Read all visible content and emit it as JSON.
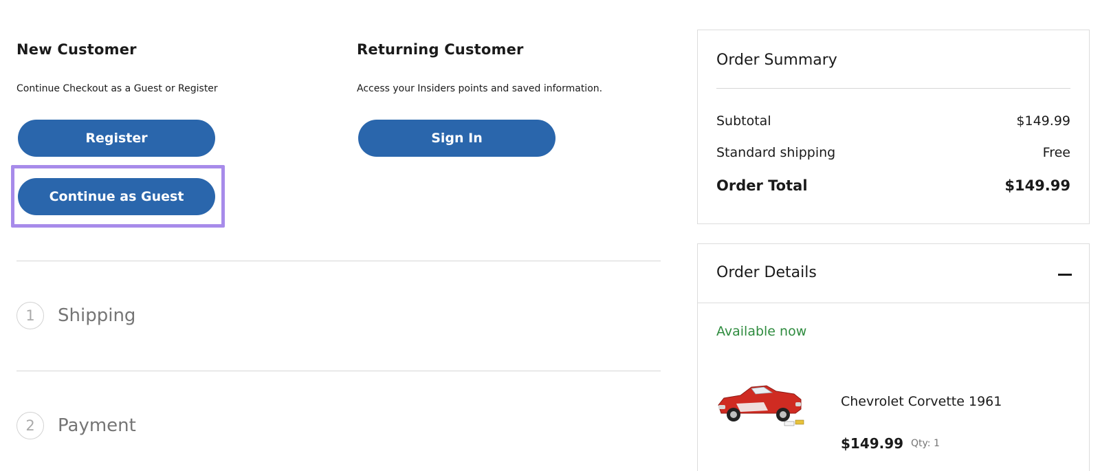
{
  "new_customer": {
    "title": "New Customer",
    "subtitle": "Continue Checkout as a Guest or Register",
    "register_label": "Register",
    "guest_label": "Continue as Guest"
  },
  "returning_customer": {
    "title": "Returning Customer",
    "subtitle": "Access your Insiders points and saved information.",
    "sign_in_label": "Sign In"
  },
  "steps": [
    {
      "number": "1",
      "label": "Shipping"
    },
    {
      "number": "2",
      "label": "Payment"
    }
  ],
  "order_summary": {
    "title": "Order Summary",
    "rows": [
      {
        "label": "Subtotal",
        "value": "$149.99"
      },
      {
        "label": "Standard shipping",
        "value": "Free"
      }
    ],
    "total_label": "Order Total",
    "total_value": "$149.99"
  },
  "order_details": {
    "title": "Order Details",
    "availability": "Available now",
    "product": {
      "name": "Chevrolet Corvette 1961",
      "price": "$149.99",
      "qty": "Qty: 1"
    }
  },
  "colors": {
    "primary_button": "#2a66ac",
    "highlight": "#a78bea",
    "available": "#2e8b3e"
  },
  "icons": {
    "collapse": "minus-icon"
  }
}
